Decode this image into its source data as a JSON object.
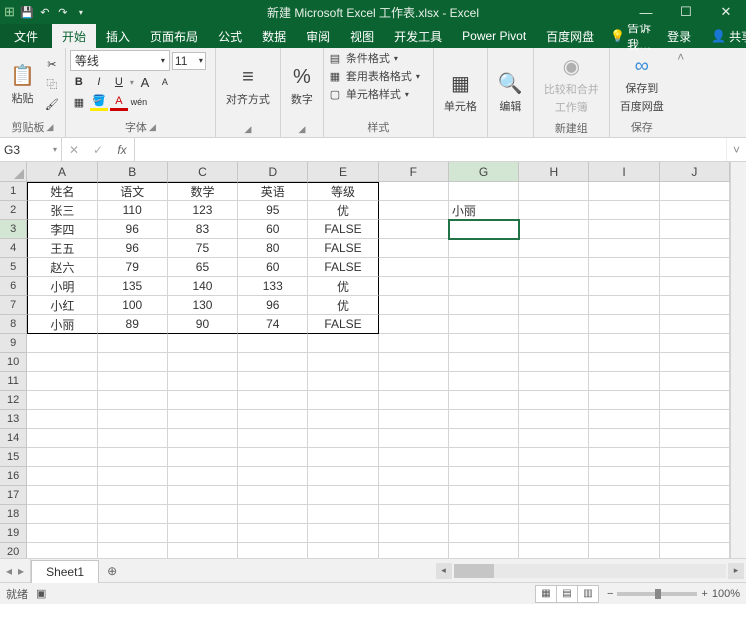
{
  "title": "新建 Microsoft Excel 工作表.xlsx - Excel",
  "qat": {
    "save": "💾",
    "undo": "↶",
    "redo": "↷"
  },
  "win": {
    "min": "—",
    "max": "☐",
    "close": "✕"
  },
  "tabs": {
    "file": "文件",
    "home": "开始",
    "insert": "插入",
    "layout": "页面布局",
    "formulas": "公式",
    "data": "数据",
    "review": "审阅",
    "view": "视图",
    "dev": "开发工具",
    "power": "Power Pivot",
    "baidu": "百度网盘",
    "tell": "告诉我…",
    "login": "登录",
    "share": "共享"
  },
  "ribbon": {
    "clipboard": {
      "paste": "粘贴",
      "label": "剪贴板"
    },
    "font": {
      "name": "等线",
      "size": "11",
      "bold": "B",
      "italic": "I",
      "underline": "U",
      "grow": "A",
      "shrink": "A",
      "phonetic": "wén",
      "label": "字体"
    },
    "align": {
      "label": "对齐方式"
    },
    "number": {
      "symbol": "%",
      "label": "数字"
    },
    "styles": {
      "cond": "条件格式",
      "table": "套用表格格式",
      "cell": "单元格样式",
      "label": "样式"
    },
    "cells": {
      "label": "单元格"
    },
    "editing": {
      "label": "编辑"
    },
    "compare": {
      "line1": "比较和合并",
      "line2": "工作簿",
      "label": "新建组"
    },
    "save": {
      "line1": "保存到",
      "line2": "百度网盘",
      "label": "保存"
    }
  },
  "namebox": "G3",
  "fx": "fx",
  "cols": [
    "A",
    "B",
    "C",
    "D",
    "E",
    "F",
    "G",
    "H",
    "I",
    "J"
  ],
  "rows": [
    {
      "n": "1",
      "cells": [
        {
          "v": "姓名",
          "c": 1
        },
        {
          "v": "语文",
          "c": 1
        },
        {
          "v": "数学",
          "c": 1
        },
        {
          "v": "英语",
          "c": 1
        },
        {
          "v": "等级",
          "c": 1
        },
        {
          "v": ""
        },
        {
          "v": ""
        },
        {
          "v": ""
        },
        {
          "v": ""
        },
        {
          "v": ""
        }
      ],
      "top": true
    },
    {
      "n": "2",
      "cells": [
        {
          "v": "张三",
          "c": 1
        },
        {
          "v": "110",
          "c": 1
        },
        {
          "v": "123",
          "c": 1
        },
        {
          "v": "95",
          "c": 1
        },
        {
          "v": "优",
          "c": 1
        },
        {
          "v": ""
        },
        {
          "v": "小丽"
        },
        {
          "v": ""
        },
        {
          "v": ""
        },
        {
          "v": ""
        }
      ]
    },
    {
      "n": "3",
      "cells": [
        {
          "v": "李四",
          "c": 1
        },
        {
          "v": "96",
          "c": 1
        },
        {
          "v": "83",
          "c": 1
        },
        {
          "v": "60",
          "c": 1
        },
        {
          "v": "FALSE",
          "c": 1
        },
        {
          "v": ""
        },
        {
          "v": "",
          "active": 1
        },
        {
          "v": ""
        },
        {
          "v": ""
        },
        {
          "v": ""
        }
      ]
    },
    {
      "n": "4",
      "cells": [
        {
          "v": "王五",
          "c": 1
        },
        {
          "v": "96",
          "c": 1
        },
        {
          "v": "75",
          "c": 1
        },
        {
          "v": "80",
          "c": 1
        },
        {
          "v": "FALSE",
          "c": 1
        },
        {
          "v": ""
        },
        {
          "v": ""
        },
        {
          "v": ""
        },
        {
          "v": ""
        },
        {
          "v": ""
        }
      ]
    },
    {
      "n": "5",
      "cells": [
        {
          "v": "赵六",
          "c": 1
        },
        {
          "v": "79",
          "c": 1
        },
        {
          "v": "65",
          "c": 1
        },
        {
          "v": "60",
          "c": 1
        },
        {
          "v": "FALSE",
          "c": 1
        },
        {
          "v": ""
        },
        {
          "v": ""
        },
        {
          "v": ""
        },
        {
          "v": ""
        },
        {
          "v": ""
        }
      ]
    },
    {
      "n": "6",
      "cells": [
        {
          "v": "小明",
          "c": 1
        },
        {
          "v": "135",
          "c": 1
        },
        {
          "v": "140",
          "c": 1
        },
        {
          "v": "133",
          "c": 1
        },
        {
          "v": "优",
          "c": 1
        },
        {
          "v": ""
        },
        {
          "v": ""
        },
        {
          "v": ""
        },
        {
          "v": ""
        },
        {
          "v": ""
        }
      ]
    },
    {
      "n": "7",
      "cells": [
        {
          "v": "小红",
          "c": 1
        },
        {
          "v": "100",
          "c": 1
        },
        {
          "v": "130",
          "c": 1
        },
        {
          "v": "96",
          "c": 1
        },
        {
          "v": "优",
          "c": 1
        },
        {
          "v": ""
        },
        {
          "v": ""
        },
        {
          "v": ""
        },
        {
          "v": ""
        },
        {
          "v": ""
        }
      ]
    },
    {
      "n": "8",
      "cells": [
        {
          "v": "小丽",
          "c": 1
        },
        {
          "v": "89",
          "c": 1
        },
        {
          "v": "90",
          "c": 1
        },
        {
          "v": "74",
          "c": 1
        },
        {
          "v": "FALSE",
          "c": 1
        },
        {
          "v": ""
        },
        {
          "v": ""
        },
        {
          "v": ""
        },
        {
          "v": ""
        },
        {
          "v": ""
        }
      ],
      "bottom": true
    },
    {
      "n": "9",
      "cells": [
        {
          "v": ""
        },
        {
          "v": ""
        },
        {
          "v": ""
        },
        {
          "v": ""
        },
        {
          "v": ""
        },
        {
          "v": ""
        },
        {
          "v": ""
        },
        {
          "v": ""
        },
        {
          "v": ""
        },
        {
          "v": ""
        }
      ]
    },
    {
      "n": "10",
      "cells": [
        {
          "v": ""
        },
        {
          "v": ""
        },
        {
          "v": ""
        },
        {
          "v": ""
        },
        {
          "v": ""
        },
        {
          "v": ""
        },
        {
          "v": ""
        },
        {
          "v": ""
        },
        {
          "v": ""
        },
        {
          "v": ""
        }
      ]
    },
    {
      "n": "11",
      "cells": [
        {
          "v": ""
        },
        {
          "v": ""
        },
        {
          "v": ""
        },
        {
          "v": ""
        },
        {
          "v": ""
        },
        {
          "v": ""
        },
        {
          "v": ""
        },
        {
          "v": ""
        },
        {
          "v": ""
        },
        {
          "v": ""
        }
      ]
    },
    {
      "n": "12",
      "cells": [
        {
          "v": ""
        },
        {
          "v": ""
        },
        {
          "v": ""
        },
        {
          "v": ""
        },
        {
          "v": ""
        },
        {
          "v": ""
        },
        {
          "v": ""
        },
        {
          "v": ""
        },
        {
          "v": ""
        },
        {
          "v": ""
        }
      ]
    },
    {
      "n": "13",
      "cells": [
        {
          "v": ""
        },
        {
          "v": ""
        },
        {
          "v": ""
        },
        {
          "v": ""
        },
        {
          "v": ""
        },
        {
          "v": ""
        },
        {
          "v": ""
        },
        {
          "v": ""
        },
        {
          "v": ""
        },
        {
          "v": ""
        }
      ]
    },
    {
      "n": "14",
      "cells": [
        {
          "v": ""
        },
        {
          "v": ""
        },
        {
          "v": ""
        },
        {
          "v": ""
        },
        {
          "v": ""
        },
        {
          "v": ""
        },
        {
          "v": ""
        },
        {
          "v": ""
        },
        {
          "v": ""
        },
        {
          "v": ""
        }
      ]
    },
    {
      "n": "15",
      "cells": [
        {
          "v": ""
        },
        {
          "v": ""
        },
        {
          "v": ""
        },
        {
          "v": ""
        },
        {
          "v": ""
        },
        {
          "v": ""
        },
        {
          "v": ""
        },
        {
          "v": ""
        },
        {
          "v": ""
        },
        {
          "v": ""
        }
      ]
    },
    {
      "n": "16",
      "cells": [
        {
          "v": ""
        },
        {
          "v": ""
        },
        {
          "v": ""
        },
        {
          "v": ""
        },
        {
          "v": ""
        },
        {
          "v": ""
        },
        {
          "v": ""
        },
        {
          "v": ""
        },
        {
          "v": ""
        },
        {
          "v": ""
        }
      ]
    },
    {
      "n": "17",
      "cells": [
        {
          "v": ""
        },
        {
          "v": ""
        },
        {
          "v": ""
        },
        {
          "v": ""
        },
        {
          "v": ""
        },
        {
          "v": ""
        },
        {
          "v": ""
        },
        {
          "v": ""
        },
        {
          "v": ""
        },
        {
          "v": ""
        }
      ]
    },
    {
      "n": "18",
      "cells": [
        {
          "v": ""
        },
        {
          "v": ""
        },
        {
          "v": ""
        },
        {
          "v": ""
        },
        {
          "v": ""
        },
        {
          "v": ""
        },
        {
          "v": ""
        },
        {
          "v": ""
        },
        {
          "v": ""
        },
        {
          "v": ""
        }
      ]
    },
    {
      "n": "19",
      "cells": [
        {
          "v": ""
        },
        {
          "v": ""
        },
        {
          "v": ""
        },
        {
          "v": ""
        },
        {
          "v": ""
        },
        {
          "v": ""
        },
        {
          "v": ""
        },
        {
          "v": ""
        },
        {
          "v": ""
        },
        {
          "v": ""
        }
      ]
    },
    {
      "n": "20",
      "cells": [
        {
          "v": ""
        },
        {
          "v": ""
        },
        {
          "v": ""
        },
        {
          "v": ""
        },
        {
          "v": ""
        },
        {
          "v": ""
        },
        {
          "v": ""
        },
        {
          "v": ""
        },
        {
          "v": ""
        },
        {
          "v": ""
        }
      ]
    }
  ],
  "sheet": {
    "name": "Sheet1",
    "add": "⊕"
  },
  "status": {
    "ready": "就绪",
    "zoom": "100%",
    "plus": "+",
    "minus": "−"
  }
}
